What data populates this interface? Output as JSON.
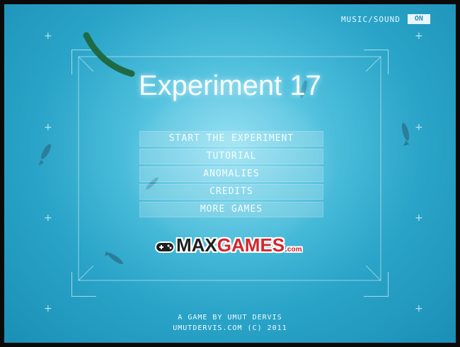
{
  "game": {
    "title": "Experiment 17"
  },
  "audio": {
    "label": "MUSIC/SOUND",
    "toggle": "ON"
  },
  "menu": {
    "items": [
      {
        "label": "START THE EXPERIMENT"
      },
      {
        "label": "TUTORIAL"
      },
      {
        "label": "ANOMALIES"
      },
      {
        "label": "CREDITS"
      },
      {
        "label": "MORE GAMES"
      }
    ]
  },
  "sponsor": {
    "part1": "MAX",
    "part2": "GAMES",
    "suffix": ".com"
  },
  "footer": {
    "line1": "A GAME BY  UMUT DERVIS",
    "line2": "UMUTDERVIS.COM (C) 2011"
  },
  "colors": {
    "background": "#3cb4d6",
    "text": "#f4fdff",
    "eel": "#1f6a45",
    "fish": "#2c7d9a",
    "logo_red": "#d8232a",
    "logo_black": "#1f1f1f"
  },
  "icons": {
    "creature": "eel-icon",
    "fish": "fish-icon",
    "sponsor_logo": "gamepad-icon"
  }
}
